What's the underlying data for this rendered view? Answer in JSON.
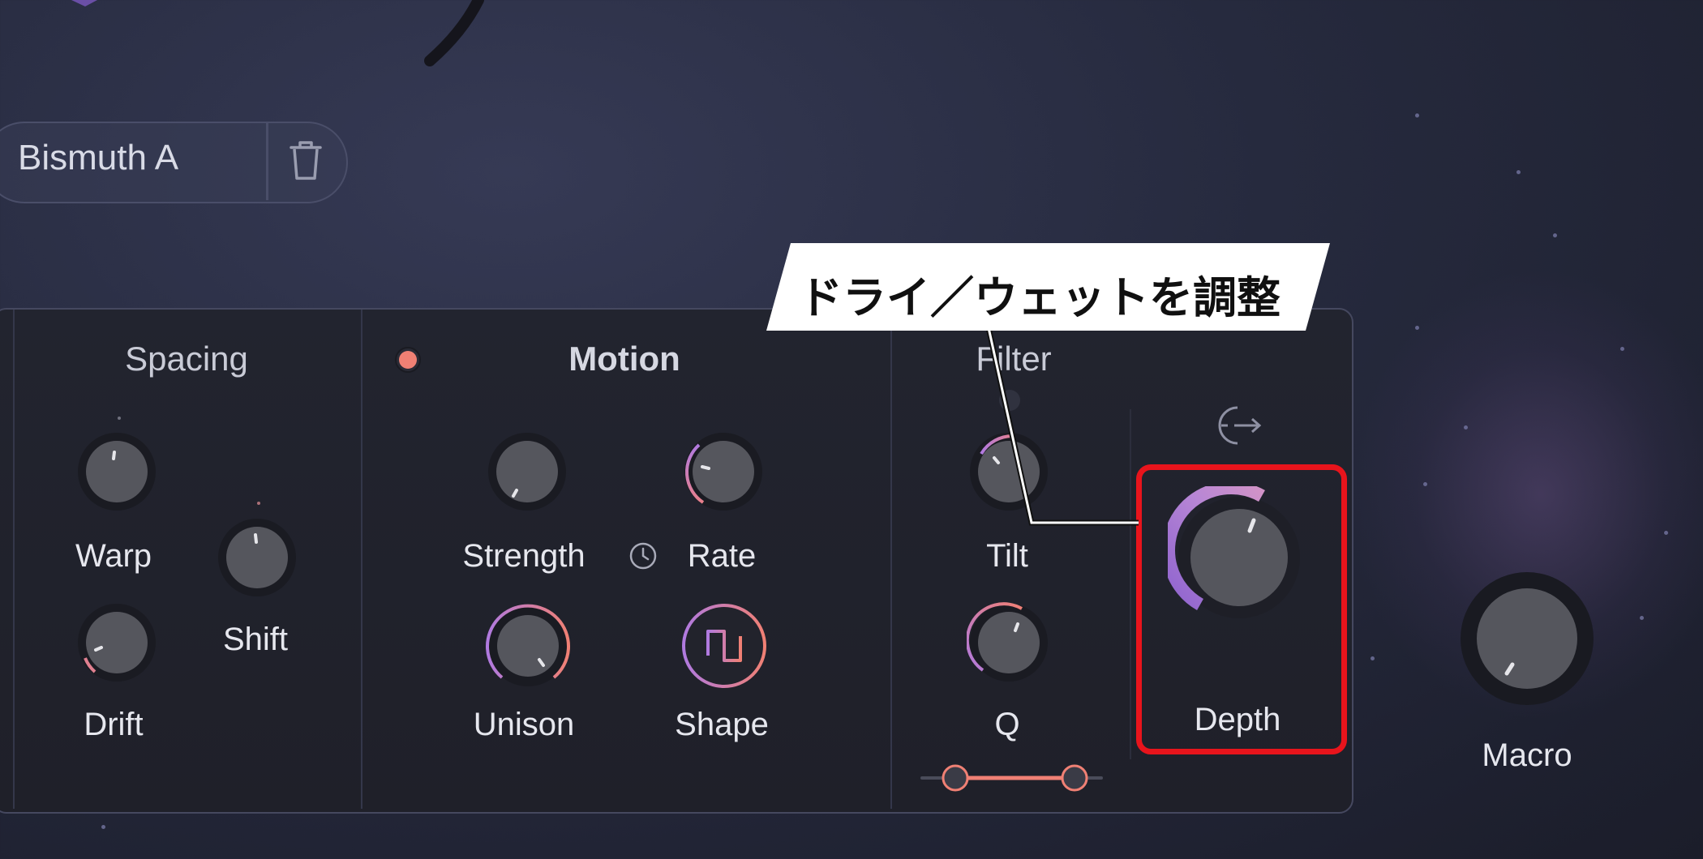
{
  "preset": {
    "name": "Bismuth A"
  },
  "sections": {
    "spacing": {
      "title": "Spacing"
    },
    "motion": {
      "title": "Motion"
    },
    "filter": {
      "title": "Filter"
    }
  },
  "knobs": {
    "warp": {
      "label": "Warp"
    },
    "shift": {
      "label": "Shift"
    },
    "drift": {
      "label": "Drift"
    },
    "strength": {
      "label": "Strength"
    },
    "rate": {
      "label": "Rate"
    },
    "unison": {
      "label": "Unison"
    },
    "shape": {
      "label": "Shape"
    },
    "tilt": {
      "label": "Tilt"
    },
    "q": {
      "label": "Q"
    },
    "depth": {
      "label": "Depth"
    },
    "macro": {
      "label": "Macro"
    }
  },
  "callout": {
    "text": "ドライ／ウェットを調整"
  },
  "icons": {
    "trash": "trash-icon",
    "clock": "clock-icon",
    "sync": "sync-icon",
    "motion_power": "power-dot-icon"
  },
  "colors": {
    "highlight": "#e8141c",
    "accent_salmon": "#f08074",
    "accent_purple": "#b07ae0",
    "panel_bg": "#22242f"
  }
}
